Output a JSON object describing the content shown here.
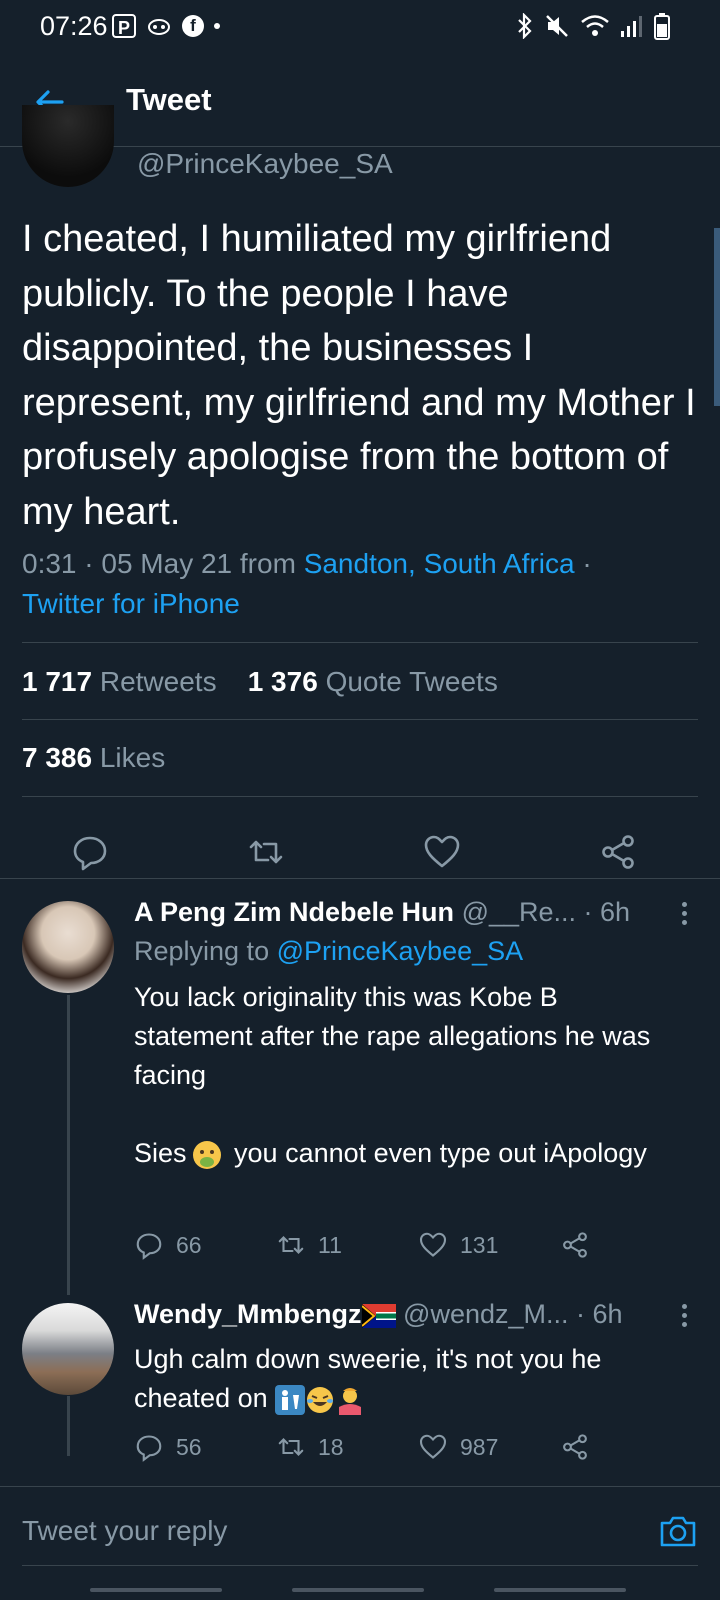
{
  "status_bar": {
    "time": "07:26",
    "left_icons": [
      "p-badge-icon",
      "mentions-icon",
      "facebook-icon",
      "dot-icon"
    ],
    "right_icons": [
      "bluetooth-icon",
      "mute-icon",
      "wifi-icon",
      "signal-icon",
      "battery-icon"
    ]
  },
  "header": {
    "title": "Tweet"
  },
  "tweet": {
    "handle": "@PrinceKaybee_SA",
    "text": "I cheated, I humiliated my girlfriend publicly. To the people I have disappointed, the businesses I represent, my girlfriend and my Mother I profusely apologise from the bottom of my heart.",
    "time": "0:31 · 05 May 21 from ",
    "location": "Sandton, South Africa",
    "sep": " · ",
    "client": "Twitter for iPhone",
    "retweets_count": "1 717",
    "retweets_label": "Retweets",
    "quotes_count": "1 376",
    "quotes_label": "Quote Tweets",
    "likes_count": "7 386",
    "likes_label": "Likes"
  },
  "replies": [
    {
      "name": "A Peng Zim Ndebele Hun",
      "handle": "@__Re...",
      "time": "· 6h",
      "replying_prefix": "Replying to ",
      "replying_to": "@PrinceKaybee_SA",
      "text_a": "You lack originality this was Kobe B statement after the rape allegations he was facing\n\nSies",
      "text_b": " you cannot even type out iApology",
      "emoji": "nauseated-face-emoji",
      "replies": "66",
      "retweets": "11",
      "likes": "131"
    },
    {
      "name": "Wendy_Mmbengz",
      "handle": "@wendz_M...",
      "time": "· 6h",
      "flag": "south-africa-flag-emoji",
      "text": "Ugh calm down sweerie, it's not you he cheated on",
      "emojis": [
        "restroom-emoji",
        "joy-emoji",
        "person-shrugging-emoji"
      ],
      "replies": "56",
      "retweets": "18",
      "likes": "987"
    }
  ],
  "reply_bar": {
    "placeholder": "Tweet your reply"
  }
}
